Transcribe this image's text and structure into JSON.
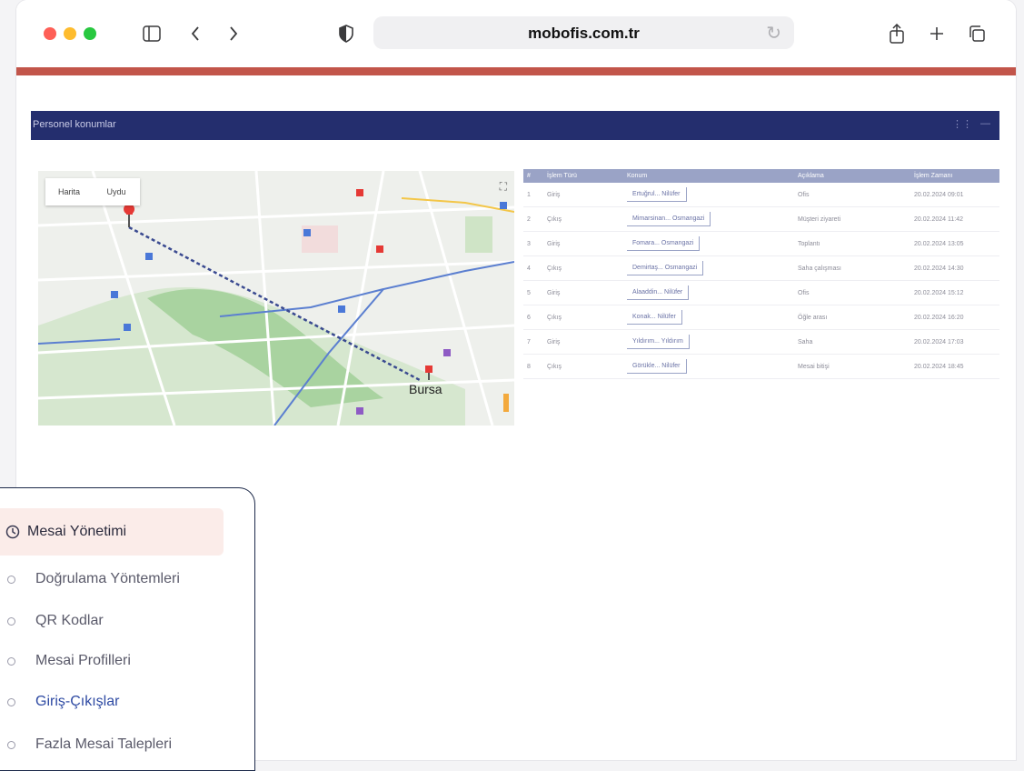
{
  "browser": {
    "url": "mobofis.com.tr"
  },
  "panel": {
    "title": "Personel konumlar",
    "controls": [
      "⋮⋮",
      "—"
    ]
  },
  "map": {
    "tab_map": "Harita",
    "tab_satellite": "Uydu",
    "city_label": "Bursa"
  },
  "table": {
    "headers": [
      "#",
      "İşlem Türü",
      "Konum",
      "Açıklama",
      "İşlem Zamanı"
    ],
    "rows": [
      [
        "1",
        "Giriş",
        "Ertuğrul... Nilüfer",
        "Ofis",
        "20.02.2024 09:01"
      ],
      [
        "2",
        "Çıkış",
        "Mimarsinan... Osmangazi",
        "Müşteri ziyareti",
        "20.02.2024 11:42"
      ],
      [
        "3",
        "Giriş",
        "Fomara... Osmangazi",
        "Toplantı",
        "20.02.2024 13:05"
      ],
      [
        "4",
        "Çıkış",
        "Demirtaş... Osmangazi",
        "Saha çalışması",
        "20.02.2024 14:30"
      ],
      [
        "5",
        "Giriş",
        "Alaaddin... Nilüfer",
        "Ofis",
        "20.02.2024 15:12"
      ],
      [
        "6",
        "Çıkış",
        "Konak... Nilüfer",
        "Öğle arası",
        "20.02.2024 16:20"
      ],
      [
        "7",
        "Giriş",
        "Yıldırım... Yıldırım",
        "Saha",
        "20.02.2024 17:03"
      ],
      [
        "8",
        "Çıkış",
        "Görükle... Nilüfer",
        "Mesai bitişi",
        "20.02.2024 18:45"
      ]
    ]
  },
  "sidebar": {
    "section_label": "Mesai Yönetimi",
    "items": [
      {
        "label": "Doğrulama Yöntemleri"
      },
      {
        "label": "QR Kodlar"
      },
      {
        "label": "Mesai Profilleri"
      },
      {
        "label": "Giriş-Çıkışlar"
      },
      {
        "label": "Fazla Mesai Talepleri"
      }
    ]
  },
  "colors": {
    "accent_bar": "#c2554a",
    "panel_header": "#242e6e",
    "active_menu": "#2e4aa3",
    "menu_highlight": "#fbece9"
  }
}
